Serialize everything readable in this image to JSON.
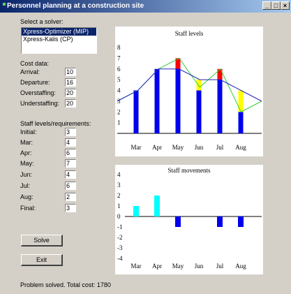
{
  "window": {
    "title": "Personnel planning at a construction site",
    "buttons": [
      "_",
      "□",
      "×"
    ]
  },
  "solver": {
    "label": "Select a solver:",
    "options": [
      "Xpress-Optimizer (MIP)",
      "Xpress-Kalis (CP)"
    ],
    "selected": 0
  },
  "cost": {
    "label": "Cost data:",
    "fields": [
      {
        "label": "Arrival:",
        "value": "10"
      },
      {
        "label": "Departure:",
        "value": "16"
      },
      {
        "label": "Overstaffing:",
        "value": "20"
      },
      {
        "label": "Understaffing:",
        "value": "20"
      }
    ]
  },
  "staff": {
    "label": "Staff levels/requirements:",
    "fields": [
      {
        "label": "Initial:",
        "value": "3"
      },
      {
        "label": "Mar:",
        "value": "4"
      },
      {
        "label": "Apr:",
        "value": "6"
      },
      {
        "label": "May:",
        "value": "7"
      },
      {
        "label": "Jun:",
        "value": "4"
      },
      {
        "label": "Jul:",
        "value": "6"
      },
      {
        "label": "Aug:",
        "value": "2"
      },
      {
        "label": "Final:",
        "value": "3"
      }
    ]
  },
  "actions": {
    "solve": "Solve",
    "exit": "Exit"
  },
  "status": "Problem solved. Total cost: 1780",
  "chart_data": [
    {
      "type": "bar",
      "title": "Staff levels",
      "categories": [
        "Mar",
        "Apr",
        "May",
        "Jun",
        "Jul",
        "Aug"
      ],
      "ylim": [
        0,
        8
      ],
      "yticks": [
        "1",
        "2",
        "3",
        "4",
        "5",
        "6",
        "7",
        "8"
      ],
      "staff_levels": [
        4,
        6,
        6,
        4,
        5,
        2
      ],
      "understaffing": [
        0,
        0,
        1,
        0,
        1,
        0
      ],
      "overstaffing": [
        0,
        0,
        0,
        1,
        0,
        2
      ],
      "requirement_line": [
        3,
        4,
        6,
        7,
        4.3,
        6,
        2,
        3
      ],
      "level_line": [
        3,
        4,
        6,
        6,
        5,
        5,
        4,
        3
      ],
      "colors": {
        "bar": "#0000ee",
        "under": "#ff0000",
        "over": "#ffff00",
        "requirement": "#33cc33",
        "level": "#2222bb"
      }
    },
    {
      "type": "bar",
      "title": "Staff movements",
      "categories": [
        "Mar",
        "Apr",
        "May",
        "Jun",
        "Jul",
        "Aug"
      ],
      "ylim": [
        -4,
        4
      ],
      "yticks": [
        "4",
        "3",
        "2",
        "1",
        "0",
        "-1",
        "-2",
        "-3",
        "-4"
      ],
      "values": [
        1,
        2,
        -1,
        0,
        -1,
        -1
      ],
      "colors": {
        "positive": "#00ffff",
        "negative": "#0000ee"
      }
    }
  ]
}
